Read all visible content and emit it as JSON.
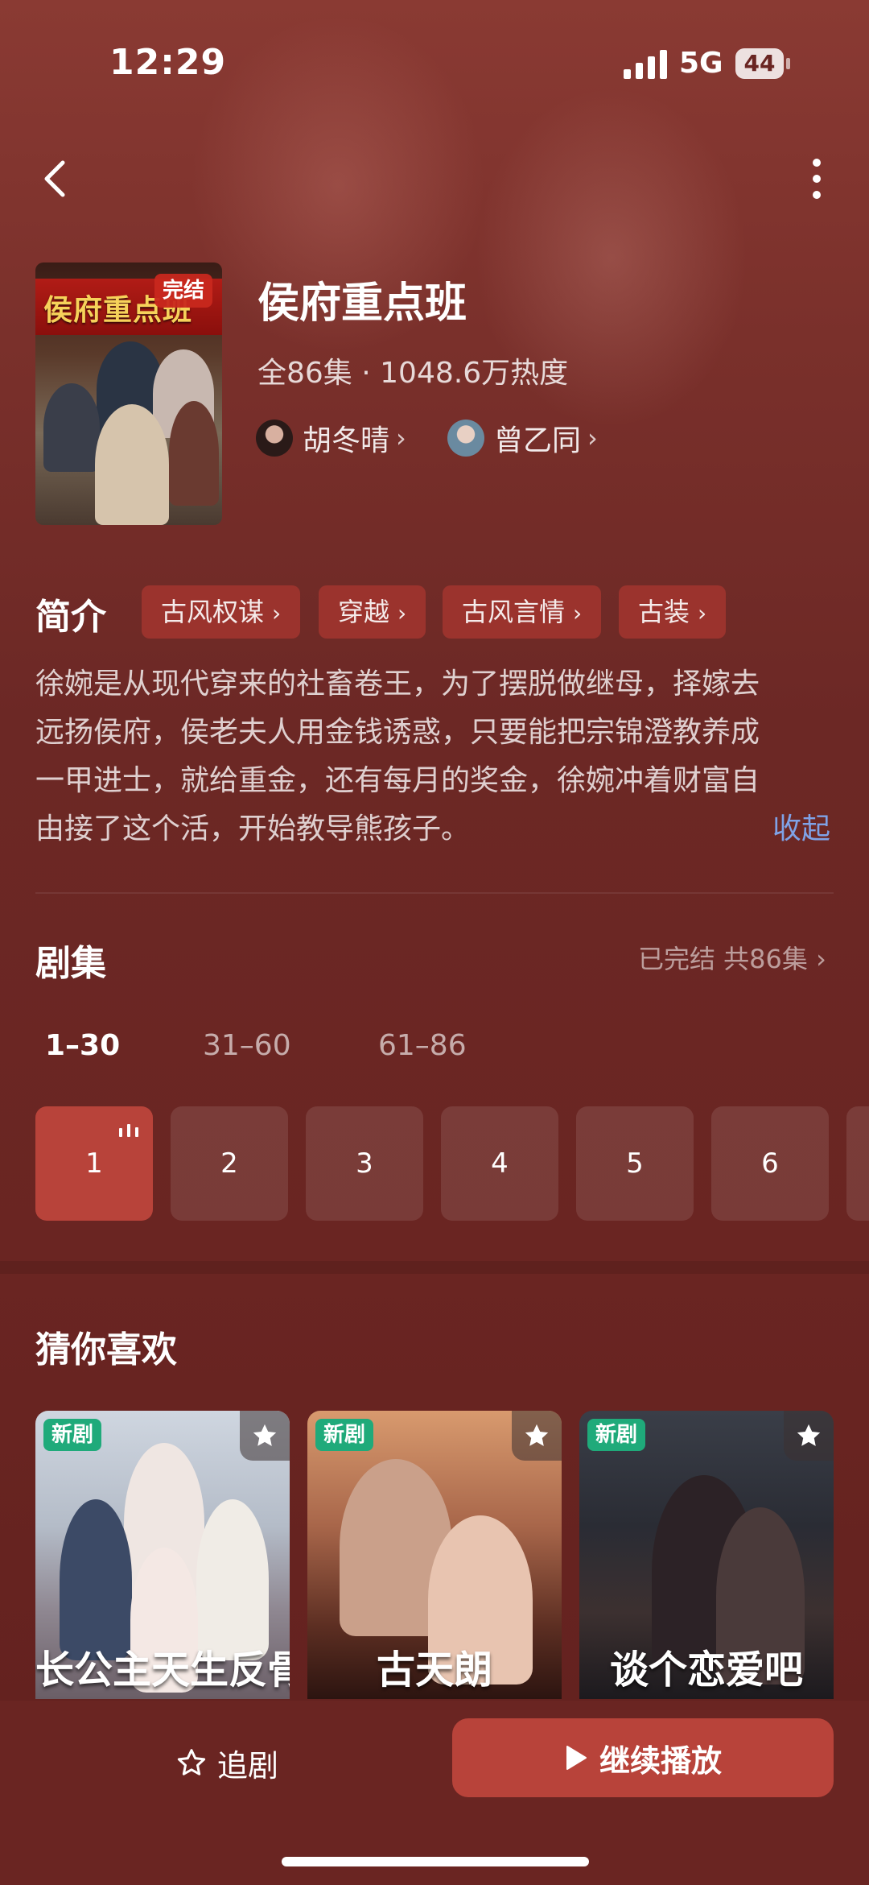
{
  "status_bar": {
    "time": "12:29",
    "network": "5G",
    "battery": "44"
  },
  "show": {
    "title": "侯府重点班",
    "meta": "全86集 · 1048.6万热度",
    "poster": {
      "title": "侯府重点班",
      "badge": "完结"
    },
    "actors": [
      {
        "name": "胡冬晴",
        "chevron": "›"
      },
      {
        "name": "曾乙同",
        "chevron": "›"
      }
    ]
  },
  "intro": {
    "heading": "简介",
    "tags": [
      {
        "label": "古风权谋",
        "chevron": "›"
      },
      {
        "label": "穿越",
        "chevron": "›"
      },
      {
        "label": "古风言情",
        "chevron": "›"
      },
      {
        "label": "古装",
        "chevron": "›"
      }
    ],
    "synopsis_lines": [
      "徐婉是从现代穿来的社畜卷王，为了摆脱做继母，择嫁去",
      "远扬侯府，侯老夫人用金钱诱惑，只要能把宗锦澄教养成",
      "一甲进士，就给重金，还有每月的奖金，徐婉冲着财富自",
      "由接了这个活，开始教导熊孩子。"
    ],
    "collapse_label": "收起"
  },
  "episodes": {
    "heading": "剧集",
    "status": "已完结 共86集 ›",
    "ranges": [
      "1–30",
      "31–60",
      "61–86"
    ],
    "active_range": 0,
    "items": [
      "1",
      "2",
      "3",
      "4",
      "5",
      "6"
    ],
    "playing_episode": "1"
  },
  "recommend": {
    "heading": "猜你喜欢",
    "cards": [
      {
        "badge": "新剧",
        "caption": "长公主天生反骨"
      },
      {
        "badge": "新剧",
        "caption": "古天朗"
      },
      {
        "badge": "新剧",
        "caption": "谈个恋爱吧"
      }
    ]
  },
  "bottom_bar": {
    "follow_label": "追剧",
    "play_label": "继续播放"
  },
  "colors": {
    "accent": "#b8433a",
    "background": "#6a2522",
    "link": "#7fa2e6",
    "new_badge": "#1faa7a"
  },
  "icons": {
    "back": "chevron-left-icon",
    "more": "more-vertical-icon",
    "follow": "star-outline-icon",
    "play": "play-icon",
    "favorite": "star-icon",
    "playing": "audio-bars-icon"
  }
}
